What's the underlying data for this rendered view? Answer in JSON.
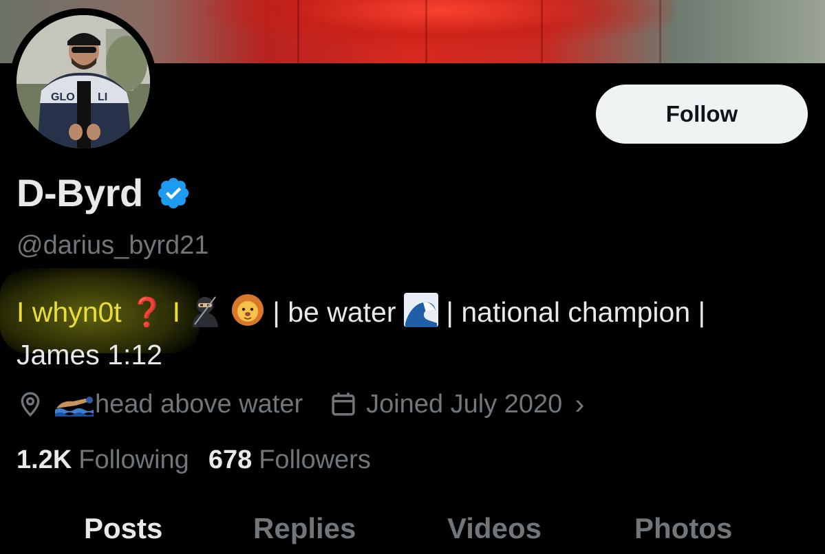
{
  "profile": {
    "display_name": "D-Byrd",
    "handle": "@darius_byrd21",
    "verified": true,
    "follow_label": "Follow"
  },
  "bio": {
    "part1": "I whyn0t",
    "part2": "❓",
    "part3": "I",
    "part4": "| be water",
    "part5": "| national champion |",
    "part6": "James 1:12"
  },
  "meta": {
    "location": "head above water",
    "joined": "Joined July 2020",
    "chevron": "›"
  },
  "stats": {
    "following_count": "1.2K",
    "following_label": "Following",
    "followers_count": "678",
    "followers_label": "Followers"
  },
  "tabs": [
    {
      "label": "Posts"
    },
    {
      "label": "Replies"
    },
    {
      "label": "Videos"
    },
    {
      "label": "Photos"
    }
  ],
  "colors": {
    "background": "#000000",
    "text_primary": "#e7e9ea",
    "text_secondary": "#71767b",
    "verified_blue": "#1d9bf0",
    "follow_bg": "#eff3f4",
    "highlight": "#e8dd3a"
  },
  "icons": {
    "verified": "verified-badge-icon",
    "location": "location-pin-icon",
    "calendar": "calendar-icon",
    "ninja": "ninja-emoji-icon",
    "lion": "lion-emoji-icon",
    "wave": "wave-emoji-icon",
    "swimmer": "swimmer-emoji-icon"
  }
}
